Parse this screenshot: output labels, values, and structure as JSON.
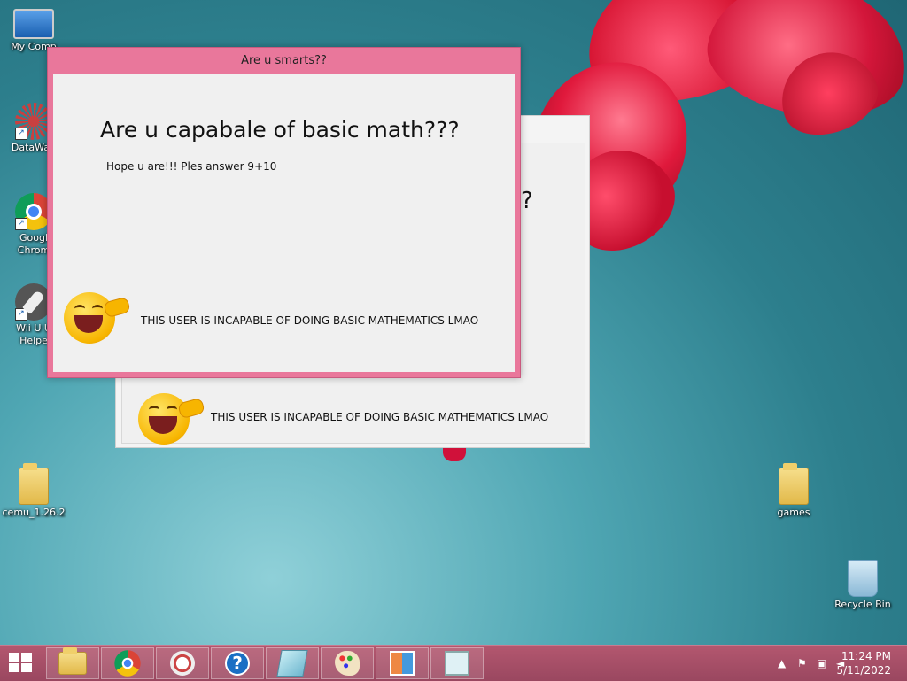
{
  "desktop_icons": [
    {
      "label": "My Comp"
    },
    {
      "label": "DataWag"
    },
    {
      "label": "Googl Chrom"
    },
    {
      "label": "Wii U U Helpe"
    },
    {
      "label": "cemu_1.26.2"
    },
    {
      "label": "games"
    },
    {
      "label": "Recycle Bin"
    }
  ],
  "back_dialog": {
    "question_fragment": "?",
    "mock_text": "THIS USER IS INCAPABLE OF DOING BASIC MATHEMATICS LMAO"
  },
  "front_dialog": {
    "title": "Are u smarts??",
    "heading": "Are u capabale of basic math???",
    "prompt": "Hope u are!!! Ples answer 9+10",
    "mock_text": "THIS USER IS INCAPABLE OF DOING BASIC MATHEMATICS LMAO"
  },
  "taskbar": {
    "items": [
      "start-icon",
      "file-explorer-icon",
      "chrome-icon",
      "snipping-icon",
      "help-icon",
      "notepad-icon",
      "paint-icon",
      "control-panel-icon",
      "task-manager-icon"
    ],
    "clock_time": "11:24 PM",
    "clock_date": "5/11/2022"
  },
  "theme": {
    "taskbar": "#a64f68",
    "dialog_border": "#e9779b"
  }
}
